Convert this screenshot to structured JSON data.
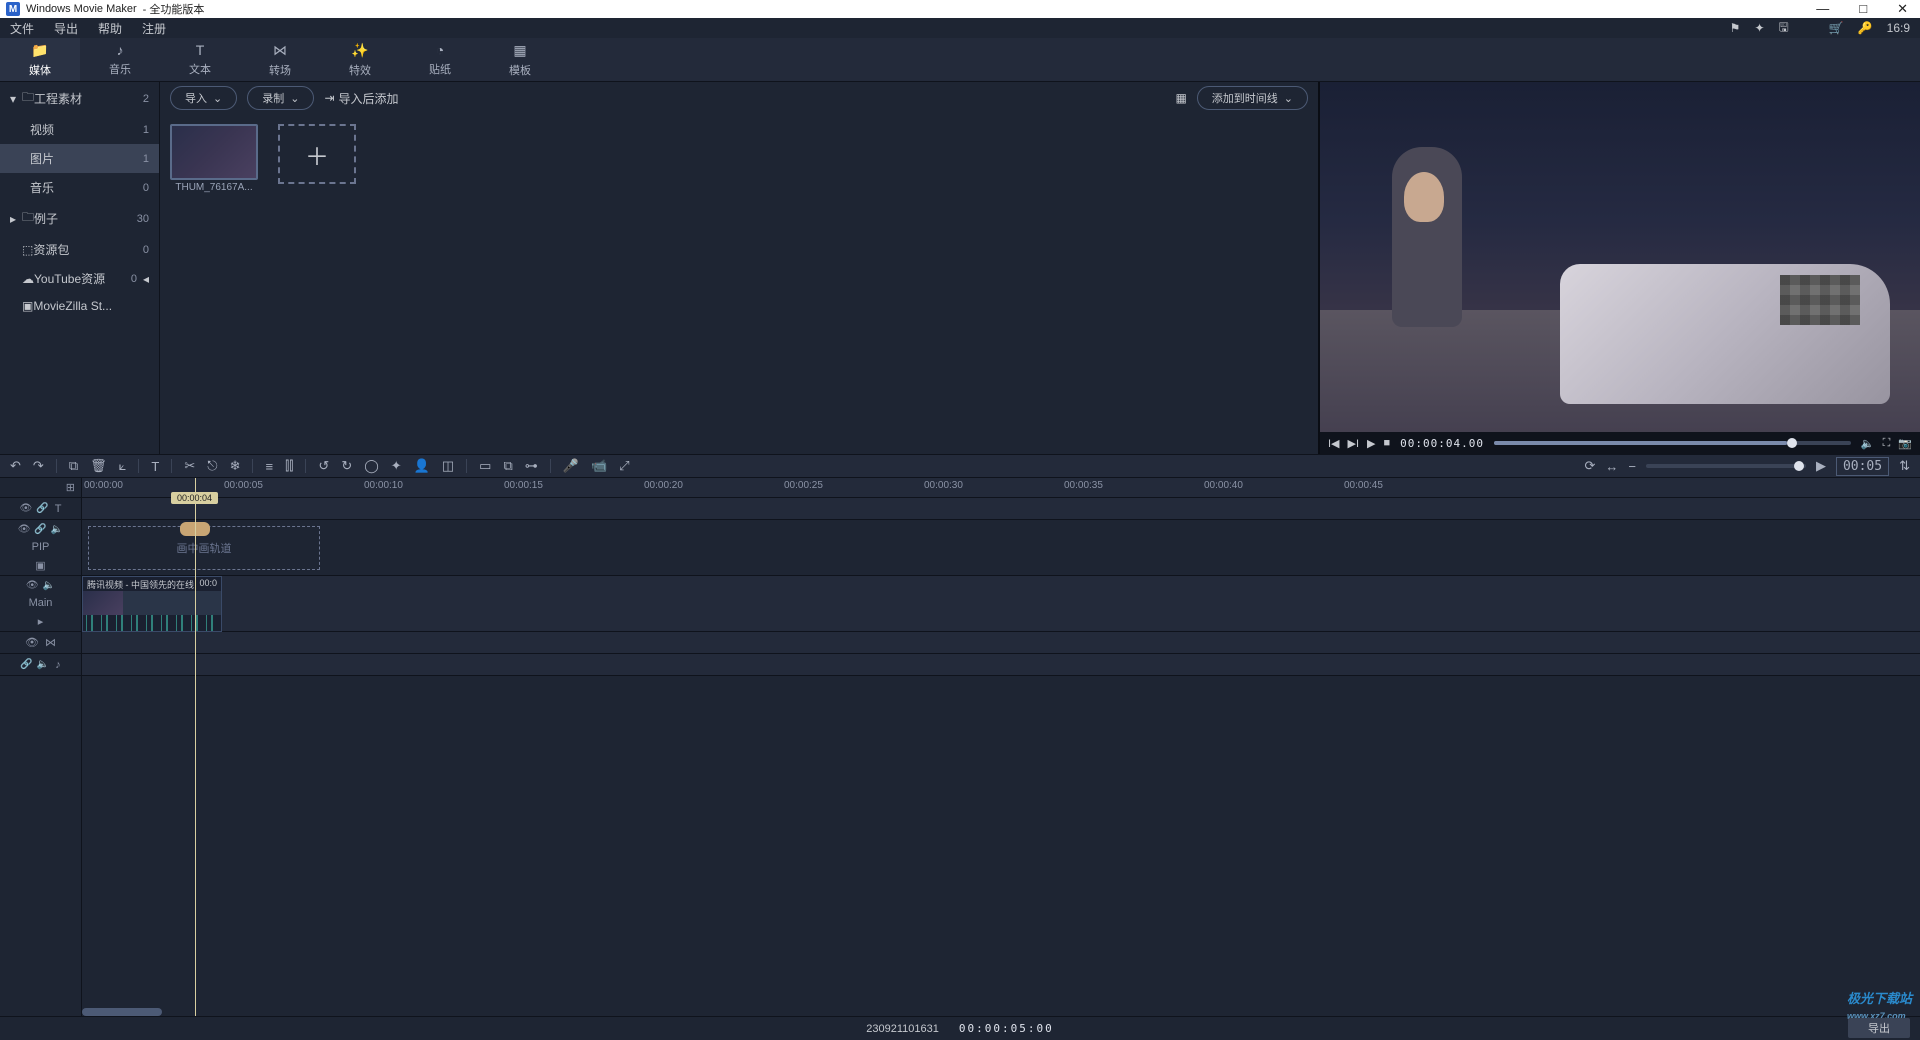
{
  "titlebar": {
    "app": "Windows Movie Maker",
    "suffix": "- 全功能版本"
  },
  "menubar": {
    "file": "文件",
    "export": "导出",
    "help": "帮助",
    "register": "注册",
    "ratio": "16:9"
  },
  "tabs": {
    "media": "媒体",
    "music": "音乐",
    "text": "文本",
    "transition": "转场",
    "effect": "特效",
    "sticker": "贴纸",
    "template": "模板"
  },
  "sidebar": {
    "project": {
      "label": "工程素材",
      "count": "2"
    },
    "video": {
      "label": "视频",
      "count": "1"
    },
    "image": {
      "label": "图片",
      "count": "1"
    },
    "audio": {
      "label": "音乐",
      "count": "0"
    },
    "examples": {
      "label": "例子",
      "count": "30"
    },
    "resource": {
      "label": "资源包",
      "count": "0"
    },
    "youtube": {
      "label": "YouTube资源",
      "count": "0"
    },
    "moviezilla": {
      "label": "MovieZilla St..."
    }
  },
  "mediabar": {
    "import": "导入",
    "record": "录制",
    "importadd": "导入后添加",
    "addtimeline": "添加到时间线"
  },
  "thumb": {
    "name": "THUM_76167A..."
  },
  "player": {
    "timecode": "00:00:04.00"
  },
  "zoom": {
    "value": "00:05"
  },
  "ruler": {
    "t0": "00:00:00",
    "t5": "00:00:05",
    "t10": "00:00:10",
    "t15": "00:00:15",
    "t20": "00:00:20",
    "t25": "00:00:25",
    "t30": "00:00:30",
    "t35": "00:00:35",
    "t40": "00:00:40",
    "t45": "00:00:45"
  },
  "playhead": {
    "time": "00:00:04"
  },
  "pip": {
    "label": "PIP",
    "placeholder": "画中画轨道"
  },
  "main": {
    "label": "Main",
    "cliptitle": "腾讯视频 - 中国领先的在线",
    "clipdur": "00:0"
  },
  "status": {
    "id": "230921101631",
    "tc": "00:00:05:00"
  },
  "export": {
    "label": "导出"
  },
  "watermark": {
    "text": "极光下载站",
    "url": "www.xz7.com"
  },
  "texttrack": {
    "label": "T"
  }
}
